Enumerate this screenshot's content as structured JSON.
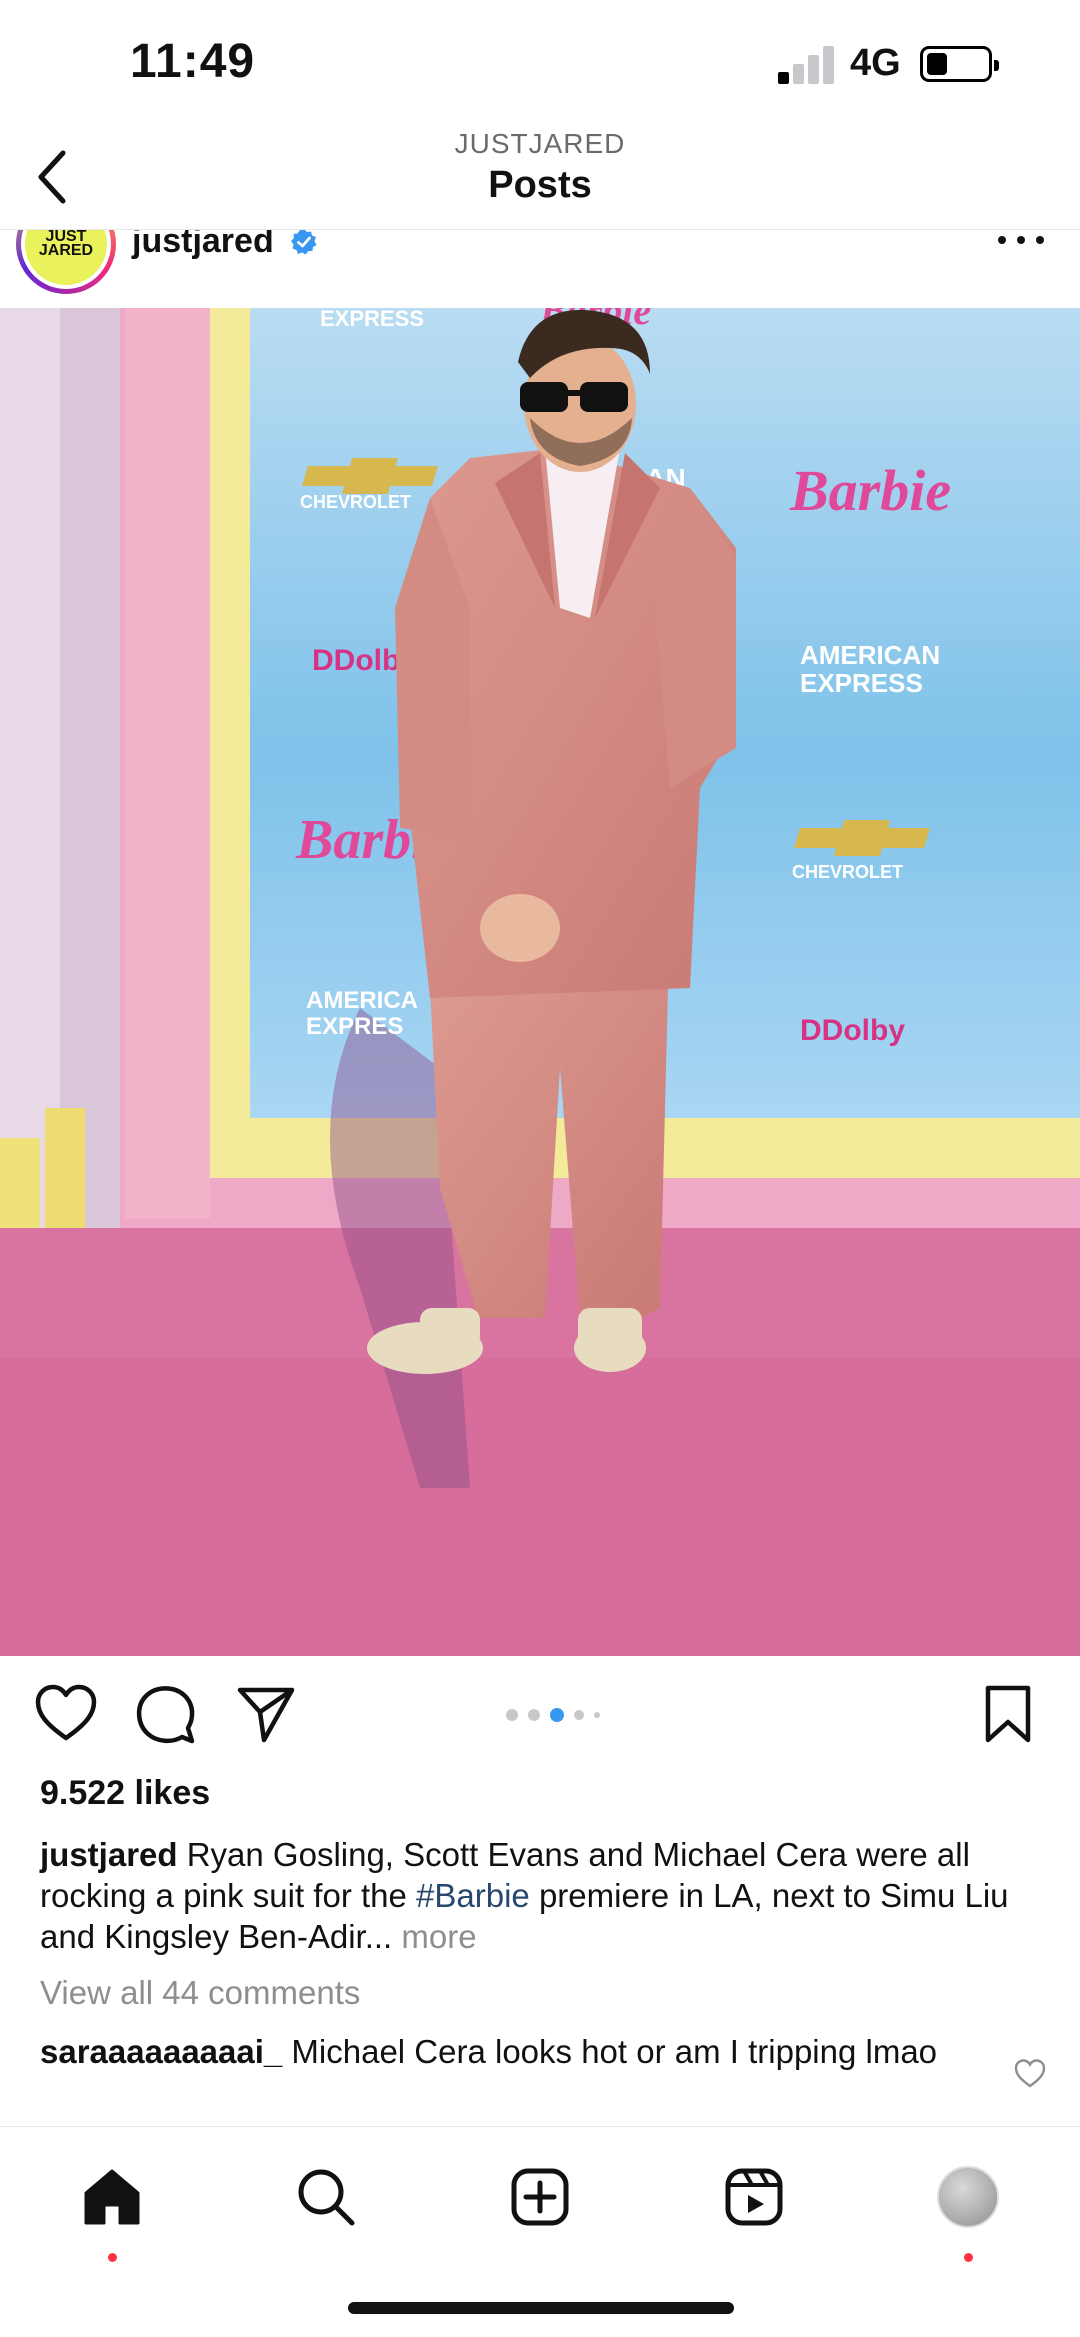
{
  "status": {
    "time": "11:49",
    "network": "4G"
  },
  "nav": {
    "subtitle": "JUSTJARED",
    "title": "Posts"
  },
  "post": {
    "username": "justjared",
    "avatar_text_1": "JUST",
    "avatar_text_2": "JARED",
    "image": {
      "backdrop_logos": [
        "Barbie",
        "CHEVROLET",
        "AMERICAN EXPRESS",
        "Dolby"
      ]
    },
    "carousel": {
      "count": 5,
      "active_index": 2
    },
    "likes": "9.522 likes",
    "caption": {
      "user": "justjared",
      "text_before": " Ryan Gosling, Scott Evans and Michael Cera were all rocking a pink suit for the ",
      "hashtag": "#Barbie",
      "text_after": " premiere in LA, next to Simu Liu and Kingsley Ben-Adir... ",
      "more": "more"
    },
    "view_comments": "View all 44 comments",
    "top_comment": {
      "user": "saraaaaaaaaai_",
      "text": " Michael Cera looks hot or am I tripping lmao"
    }
  },
  "icons": {
    "back": "chevron-left-icon",
    "verified": "verified-badge-icon",
    "more": "more-dots-icon",
    "like": "heart-icon",
    "comment": "comment-icon",
    "share": "send-icon",
    "save": "bookmark-icon",
    "home": "home-icon",
    "search": "search-icon",
    "create": "add-post-icon",
    "reels": "reels-icon"
  },
  "colors": {
    "notification": "#ff3040",
    "verified": "#3897f0",
    "hashtag": "#27496d"
  }
}
